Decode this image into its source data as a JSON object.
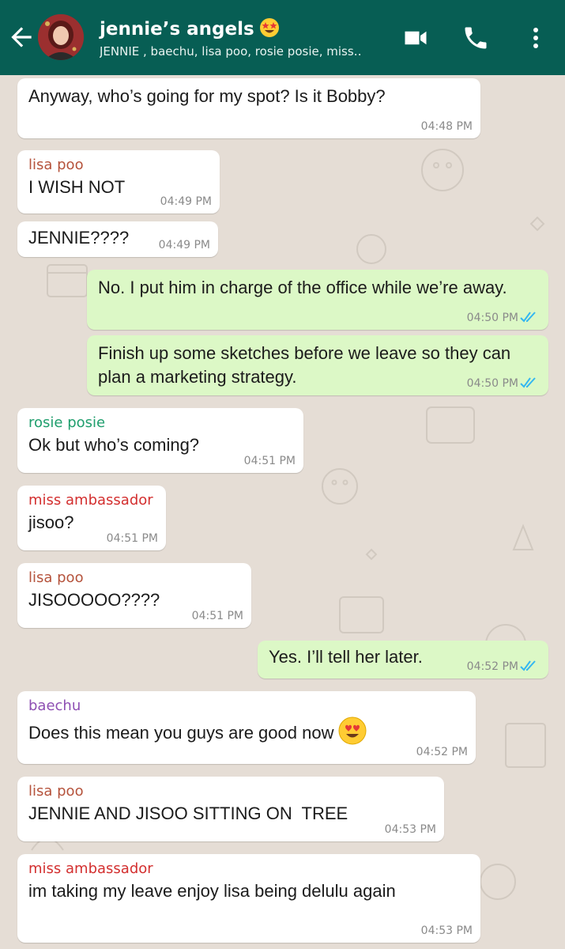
{
  "header": {
    "title": "jennie’s angels",
    "title_emoji": "star-struck-emoji",
    "subtitle": "JENNIE , baechu, lisa poo, rosie posie, miss‥",
    "back_icon": "arrow-left-icon",
    "video_icon": "video-camera-icon",
    "call_icon": "phone-icon",
    "more_icon": "more-vert-icon",
    "bar_color": "#075e54"
  },
  "colors": {
    "chat_background": "#e5ddd5",
    "incoming_bubble": "#ffffff",
    "outgoing_bubble": "#dcf8c6",
    "read_ticks": "#34b7f1"
  },
  "messages": [
    {
      "direction": "in",
      "sender": "",
      "text": "Anyway, who’s going for my spot? Is it Bobby?",
      "time": "04:48 PM"
    },
    {
      "direction": "in",
      "sender": "lisa poo",
      "sender_color": "#b5533c",
      "text": "I WISH NOT",
      "time": "04:49 PM"
    },
    {
      "direction": "in",
      "sender": "",
      "text": "JENNIE????",
      "time": "04:49 PM"
    },
    {
      "direction": "out",
      "text": "No. I put him in charge of the office while we’re away.",
      "time": "04:50 PM",
      "status": "read"
    },
    {
      "direction": "out",
      "text": "Finish up some sketches before we leave so they can plan a marketing strategy.",
      "time": "04:50 PM",
      "status": "read"
    },
    {
      "direction": "in",
      "sender": "rosie posie",
      "sender_color": "#1f9e6d",
      "text": "Ok but who’s coming?",
      "time": "04:51 PM"
    },
    {
      "direction": "in",
      "sender": "miss ambassador",
      "sender_color": "#d32f2f",
      "text": "jisoo?",
      "time": "04:51 PM"
    },
    {
      "direction": "in",
      "sender": "lisa poo",
      "sender_color": "#b5533c",
      "text": "JISOOOOO????",
      "time": "04:51 PM"
    },
    {
      "direction": "out",
      "text": "Yes. I’ll tell her later.",
      "time": "04:52 PM",
      "status": "read"
    },
    {
      "direction": "in",
      "sender": "baechu",
      "sender_color": "#8e4fb3",
      "text": "Does this mean you guys are good now",
      "emoji": "heart-eyes-emoji",
      "time": "04:52 PM"
    },
    {
      "direction": "in",
      "sender": "lisa poo",
      "sender_color": "#b5533c",
      "text": "JENNIE AND JISOO SITTING ON  TREE",
      "time": "04:53 PM"
    },
    {
      "direction": "in",
      "sender": "miss ambassador",
      "sender_color": "#d32f2f",
      "text": "im taking my leave enjoy lisa being delulu again",
      "time": "04:53 PM"
    }
  ]
}
